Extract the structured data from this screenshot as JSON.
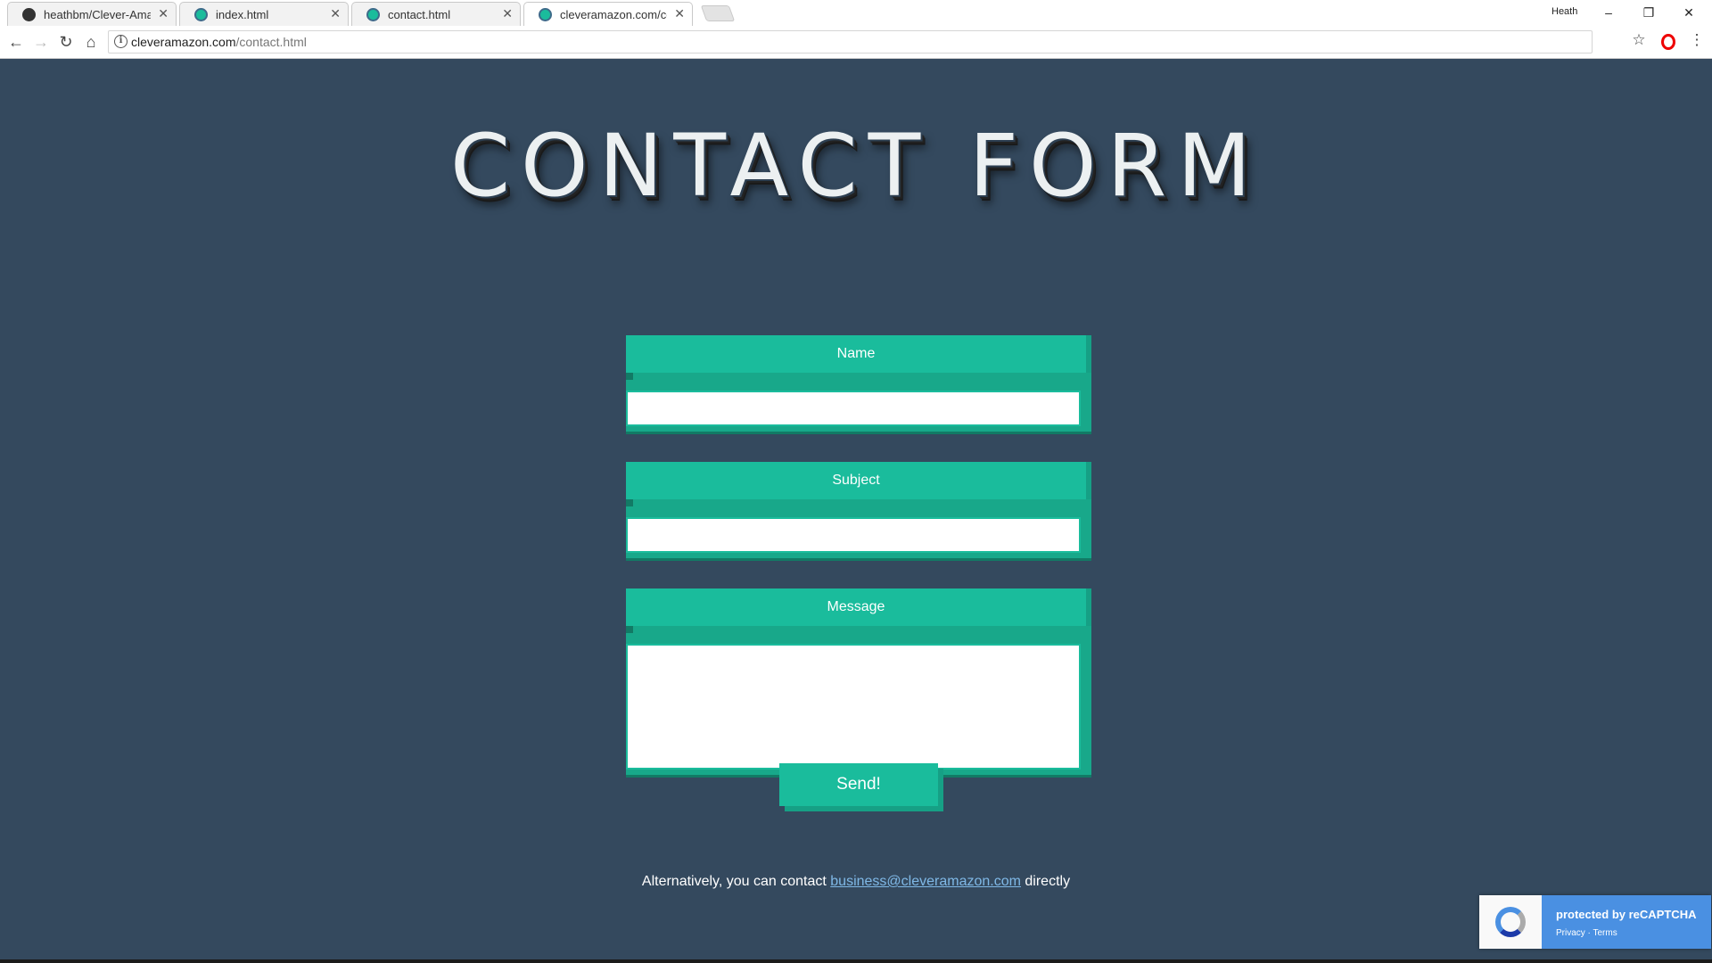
{
  "browser": {
    "tabs": [
      {
        "title": "heathbm/Clever-Amazon",
        "icon": "github-icon"
      },
      {
        "title": "index.html",
        "icon": "site-icon"
      },
      {
        "title": "contact.html",
        "icon": "site-icon"
      },
      {
        "title": "cleveramazon.com/contact.html",
        "icon": "site-icon"
      }
    ],
    "tab_close": "✕",
    "profile": "Heath",
    "window": {
      "minimize": "–",
      "restore": "❐",
      "close": "✕"
    },
    "nav": {
      "back": "←",
      "forward": "→",
      "reload": "↻",
      "home": "⌂"
    },
    "address": {
      "info": "i",
      "domain": "cleveramazon.com",
      "path": "/contact.html"
    },
    "star": "☆",
    "menu": "⋮"
  },
  "page": {
    "heading": "CONTACT FORM",
    "fields": {
      "name": {
        "label": "Name",
        "value": ""
      },
      "subject": {
        "label": "Subject",
        "value": ""
      },
      "message": {
        "label": "Message",
        "value": ""
      }
    },
    "send_label": "Send!",
    "alt_prefix": "Alternatively, you can contact ",
    "alt_email": "business@cleveramazon.com",
    "alt_suffix": " directly"
  },
  "recaptcha": {
    "line1": "protected by reCAPTCHA",
    "line2": "Privacy · Terms"
  },
  "colors": {
    "page_bg": "#34495e",
    "accent": "#1abc9c",
    "accent_dark": "#16a085",
    "link": "#7fb8e6",
    "recaptcha_blue": "#4a90e2"
  }
}
